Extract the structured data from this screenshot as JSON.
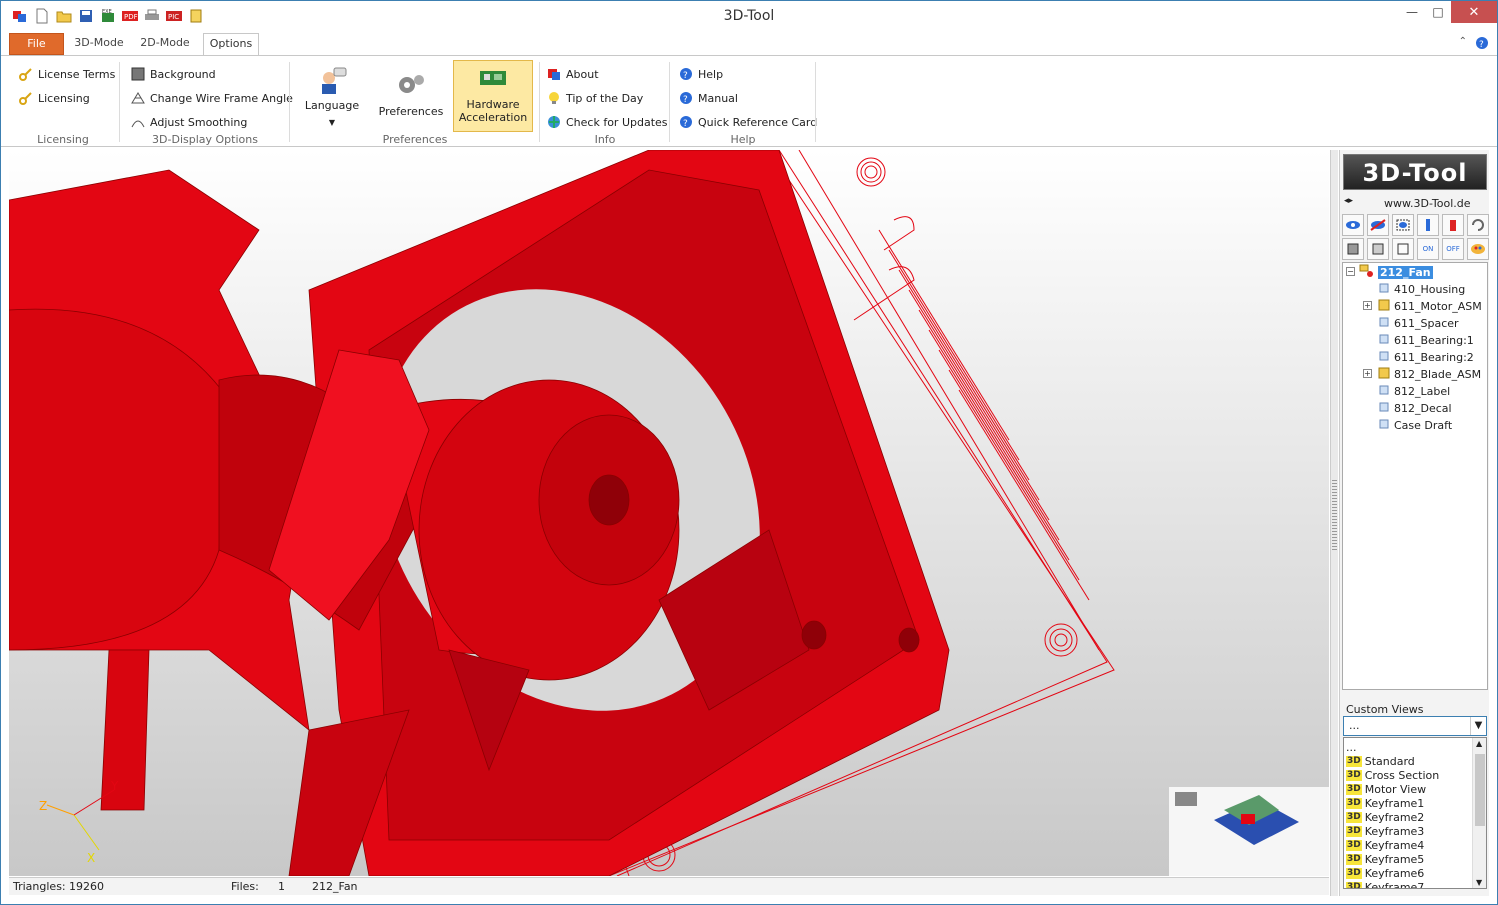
{
  "app": {
    "title": "3D-Tool",
    "accent": "#3c7fb1",
    "file_tab_color": "#e06a2b"
  },
  "quick_access": [
    "app-icon",
    "new-icon",
    "open-icon",
    "save-icon",
    "save-exe-icon",
    "export-pdf-icon",
    "print-icon",
    "export-pic-icon",
    "screenshot-icon"
  ],
  "tabs": [
    {
      "label": "File"
    },
    {
      "label": "3D-Mode"
    },
    {
      "label": "2D-Mode"
    },
    {
      "label": "Options"
    }
  ],
  "ribbon": {
    "licensing": {
      "label": "Licensing",
      "items": [
        "License Terms",
        "Licensing"
      ]
    },
    "display": {
      "label": "3D-Display Options",
      "items": [
        "Background",
        "Change Wire Frame Angle",
        "Adjust Smoothing"
      ]
    },
    "preferences": {
      "label": "Preferences",
      "language": "Language",
      "preferences": "Preferences",
      "hardware_line1": "Hardware",
      "hardware_line2": "Acceleration"
    },
    "info": {
      "label": "Info",
      "items": [
        "About",
        "Tip of the Day",
        "Check for Updates"
      ]
    },
    "help": {
      "label": "Help",
      "items": [
        "Help",
        "Manual",
        "Quick Reference Card"
      ]
    }
  },
  "status": {
    "triangles_label": "Triangles:",
    "triangles_value": "19260",
    "files_label": "Files:",
    "files_value": "1",
    "file_name": "212_Fan"
  },
  "panel": {
    "logo": "3D-Tool",
    "url": "www.3D-Tool.de",
    "tree": {
      "root": "212_Fan",
      "children": [
        "410_Housing",
        "611_Motor_ASM",
        "611_Spacer",
        "611_Bearing:1",
        "611_Bearing:2",
        "812_Blade_ASM",
        "812_Label",
        "812_Decal",
        "Case Draft"
      ]
    },
    "custom_views": {
      "label": "Custom Views",
      "selected": "...",
      "badge": "3D",
      "options": [
        "...",
        "Standard",
        "Cross Section",
        "Motor View",
        "Keyframe1",
        "Keyframe2",
        "Keyframe3",
        "Keyframe4",
        "Keyframe5",
        "Keyframe6",
        "Keyframe7"
      ]
    }
  },
  "axes": {
    "x": "X",
    "y": "Y",
    "z": "Z"
  },
  "model_color": "#e30613"
}
